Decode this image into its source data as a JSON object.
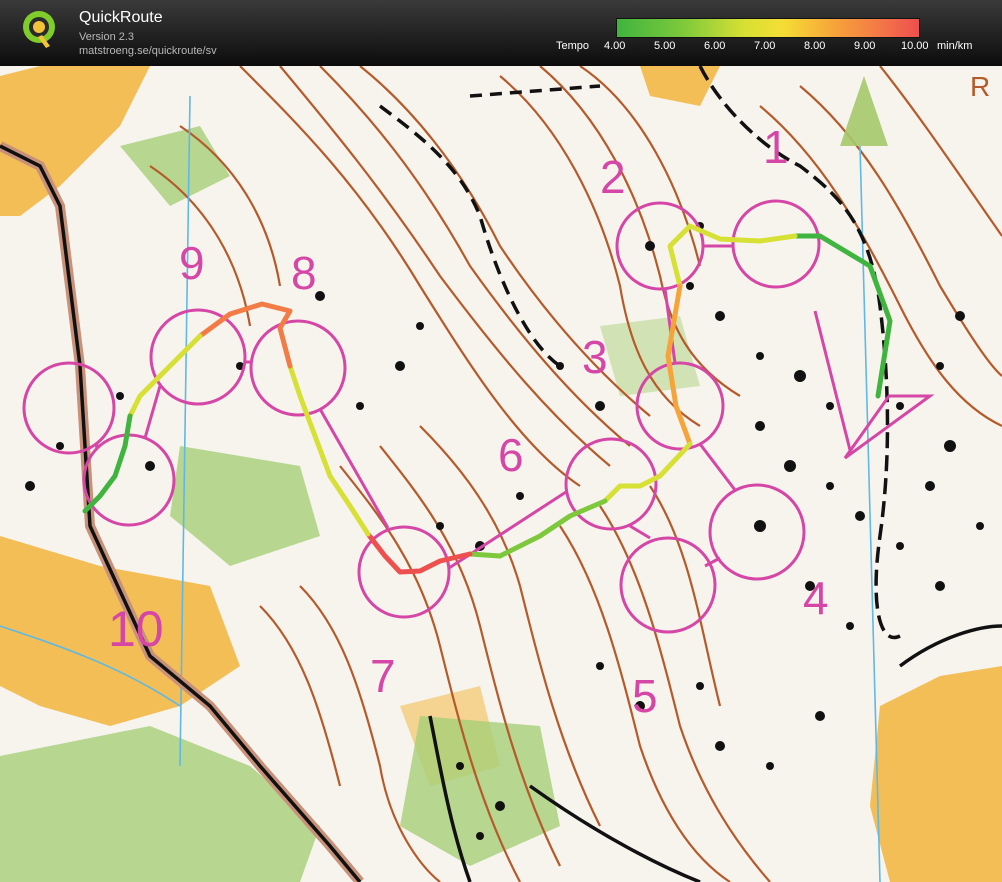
{
  "app": {
    "title": "QuickRoute",
    "version": "Version 2.3",
    "url": "matstroeng.se/quickroute/sv"
  },
  "legend": {
    "label": "Tempo",
    "ticks": [
      "4.00",
      "5.00",
      "6.00",
      "7.00",
      "8.00",
      "9.00",
      "10.00"
    ],
    "unit": "min/km",
    "colors": [
      "#3fb43f",
      "#d7e034",
      "#f6a43a",
      "#ee4f4f"
    ]
  },
  "map": {
    "controls": [
      "1",
      "2",
      "3",
      "4",
      "5",
      "6",
      "7",
      "8",
      "9",
      "10"
    ],
    "corner_letter": "R",
    "colors": {
      "paper": "#f7f4ee",
      "contour": "#b55a2a",
      "course": "#d546a6",
      "open": "#f2b43a",
      "green": "#a7cf77",
      "water": "#5eb9e6",
      "track": "#111111"
    }
  }
}
